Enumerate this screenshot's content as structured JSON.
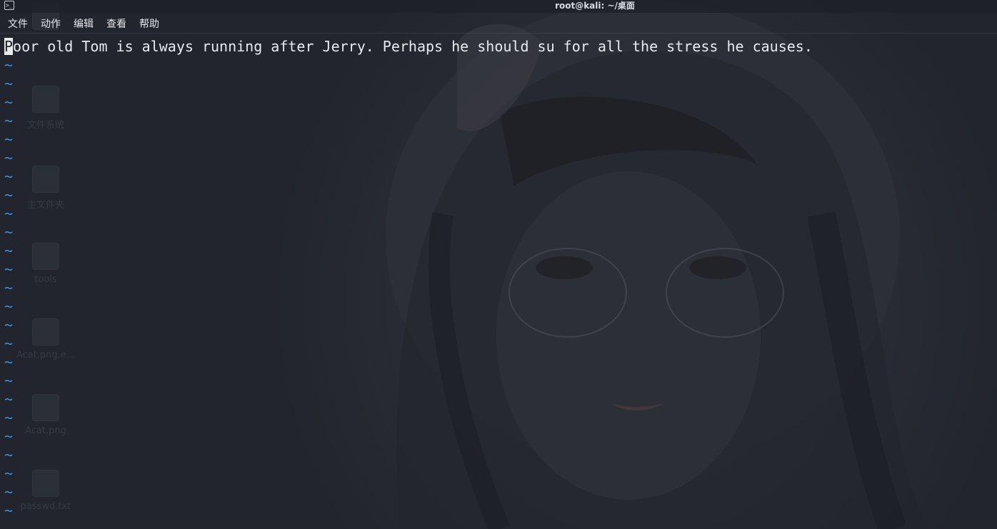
{
  "window": {
    "title": "root@kali: ~/桌面",
    "icon": "terminal-icon"
  },
  "menu": {
    "items": [
      "文件",
      "动作",
      "编辑",
      "查看",
      "帮助"
    ]
  },
  "editor": {
    "cursor_char": "P",
    "line_rest": "oor old Tom is always running after Jerry. Perhaps he should su for all the stress he causes.",
    "empty_line_marker": "~",
    "empty_line_color": "#3f8fd6",
    "text_color": "#e8eaee"
  },
  "desktop_icons": [
    {
      "label": "",
      "icon": "trash-icon"
    },
    {
      "label": "文件系统",
      "icon": "disk-icon"
    },
    {
      "label": "主文件夹",
      "icon": "home-folder-icon"
    },
    {
      "label": "tools",
      "icon": "folder-icon"
    },
    {
      "label": "Acat.png.e...",
      "icon": "folder-icon"
    },
    {
      "label": "Acat.png",
      "icon": "executable-icon"
    },
    {
      "label": "passwd.txt",
      "icon": "text-file-icon"
    }
  ]
}
